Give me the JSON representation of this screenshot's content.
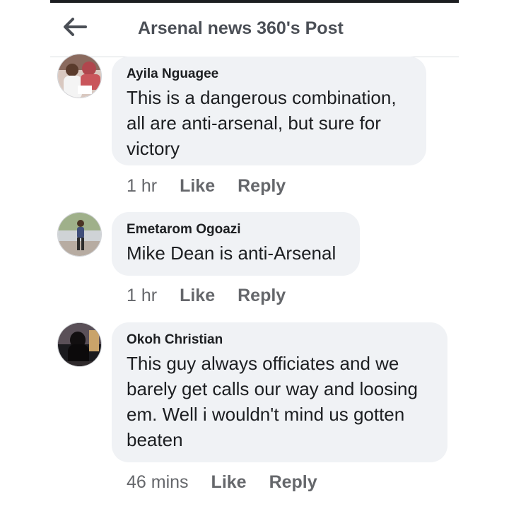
{
  "header": {
    "title": "Arsenal news 360's Post",
    "back_icon": "arrow-left-icon"
  },
  "comments": [
    {
      "author": "Ayila Nguagee",
      "text": "This is a dangerous combination, all are anti-arsenal, but sure for victory",
      "time": "1 hr",
      "like_label": "Like",
      "reply_label": "Reply"
    },
    {
      "author": "Emetarom Ogoazi",
      "text": "Mike Dean is anti-Arsenal",
      "time": "1 hr",
      "like_label": "Like",
      "reply_label": "Reply"
    },
    {
      "author": "Okoh Christian",
      "text": "This guy always officiates and we barely get calls our way and loosing em. Well i wouldn't mind us gotten beaten",
      "time": "46 mins",
      "like_label": "Like",
      "reply_label": "Reply"
    }
  ],
  "colors": {
    "bubble": "#f0f2f5",
    "text": "#1c1e21",
    "meta": "#65676b"
  }
}
